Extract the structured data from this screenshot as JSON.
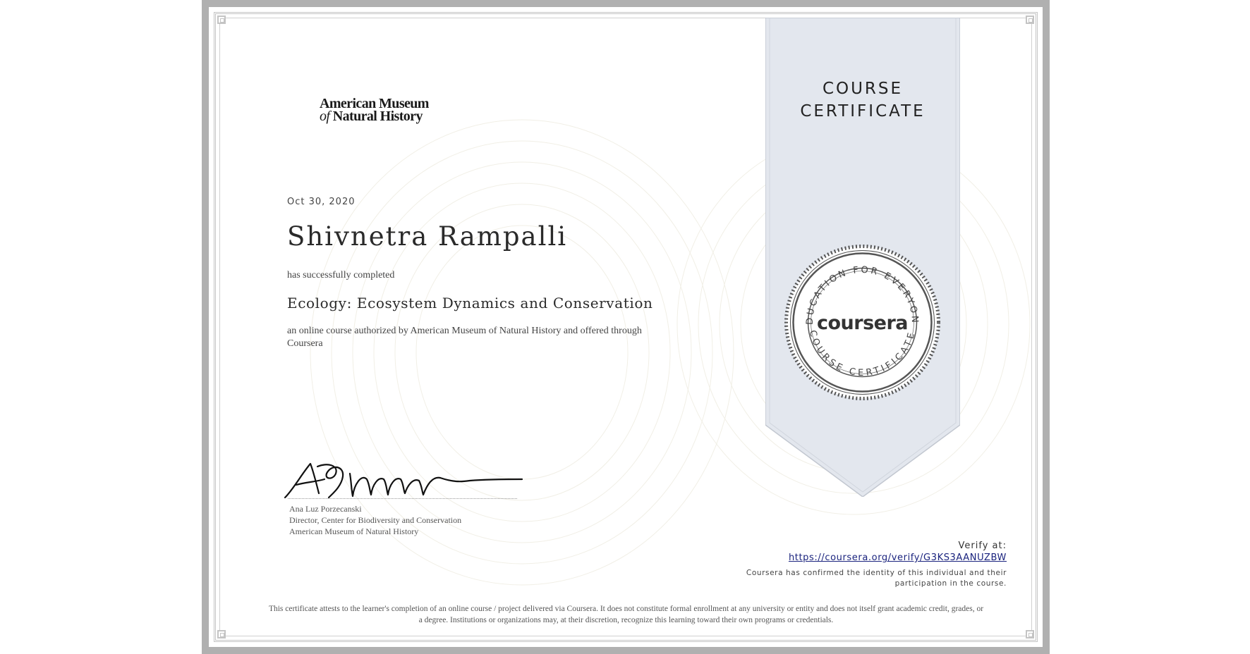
{
  "ribbon": {
    "line1": "COURSE",
    "line2": "CERTIFICATE",
    "fill": "#e3e7ee",
    "stroke": "#c2c7d0"
  },
  "issuer": {
    "line1": "American Museum",
    "of_word": "of",
    "line2": "Natural History"
  },
  "certificate": {
    "date": "Oct 30, 2020",
    "recipient": "Shivnetra Rampalli",
    "completed_text": "has successfully completed",
    "course_title": "Ecology: Ecosystem Dynamics and Conservation",
    "authorized_text": "an online course authorized by American Museum of Natural History and offered through Coursera"
  },
  "signer": {
    "name": "Ana Luz Porzecanski",
    "title": "Director, Center for Biodiversity and Conservation",
    "organization": "American Museum of Natural History"
  },
  "seal": {
    "brand": "coursera",
    "top_arc": "EDUCATION FOR EVERYONE",
    "bottom_arc": "COURSE CERTIFICATE"
  },
  "verify": {
    "label": "Verify at:",
    "url": "https://coursera.org/verify/G3KS3AANUZBW",
    "line1": "Coursera has confirmed the identity of this individual and their",
    "line2": "participation in the course."
  },
  "disclaimer": {
    "line1": "This certificate attests to the learner's completion of an online course / project delivered via Coursera. It does not constitute formal enrollment at any university or entity and does not itself grant academic credit, grades, or",
    "line2": "a degree. Institutions or organizations may, at their discretion, recognize this learning toward their own programs or credentials."
  },
  "colors": {
    "frame": "#b0b0b0",
    "link": "#1a237e"
  }
}
